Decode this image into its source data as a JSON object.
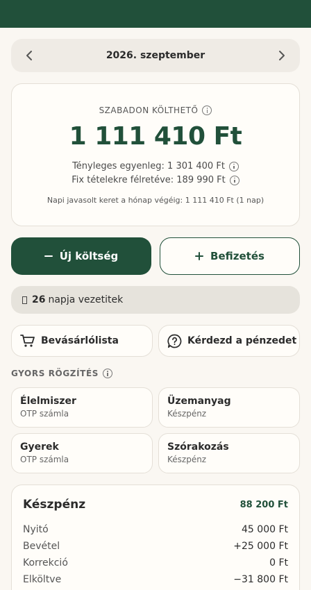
{
  "month_nav": {
    "label": "2026. szeptember"
  },
  "summary": {
    "label": "SZABADON KÖLTHETŐ",
    "amount": "1 111 410 Ft",
    "actual_balance": "Tényleges egyenleg: 1 301 400 Ft",
    "reserved": "Fix tételekre félretéve: 189 990 Ft",
    "daily_hint": "Napi javasolt keret a hónap végéig: 1 111 410 Ft (1 nap)"
  },
  "actions": {
    "new_expense": "Új költség",
    "deposit": "Befizetés"
  },
  "streak": {
    "count": "26",
    "text": "napja vezetitek"
  },
  "shortcuts": {
    "shopping_list": "Bevásárlólista",
    "ask_money": "Kérdezd a pénzedet"
  },
  "quick_entry": {
    "title": "GYORS RÖGZÍTÉS",
    "tiles": [
      {
        "name": "Élelmiszer",
        "account": "OTP számla"
      },
      {
        "name": "Üzemanyag",
        "account": "Készpénz"
      },
      {
        "name": "Gyerek",
        "account": "OTP számla"
      },
      {
        "name": "Szórakozás",
        "account": "Készpénz"
      }
    ]
  },
  "account_card": {
    "name": "Készpénz",
    "balance": "88 200 Ft",
    "rows": [
      {
        "label": "Nyitó",
        "value": "45 000 Ft"
      },
      {
        "label": "Bevétel",
        "value": "+25 000 Ft"
      },
      {
        "label": "Korrekció",
        "value": "0 Ft"
      },
      {
        "label": "Elköltve",
        "value": "−31 800 Ft"
      }
    ]
  },
  "colors": {
    "brand": "#21503a",
    "background": "#faf7f2"
  },
  "icons": [
    "chevron-left-icon",
    "chevron-right-icon",
    "info-icon",
    "minus-icon",
    "plus-icon",
    "cart-icon",
    "question-bubble-icon"
  ]
}
